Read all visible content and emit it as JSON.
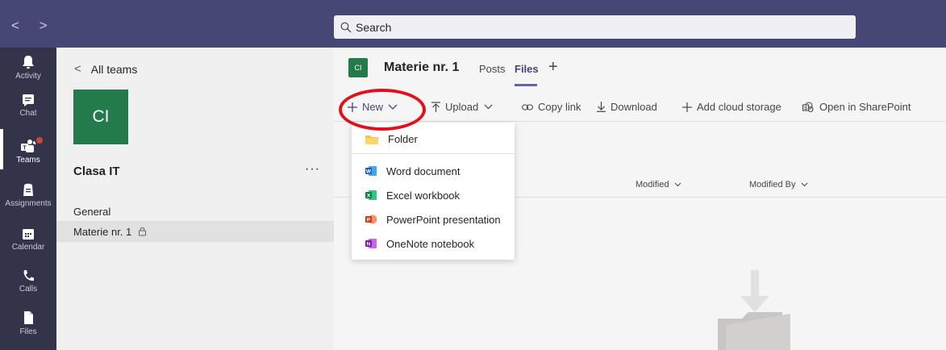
{
  "titlebar": {
    "nav": "< >",
    "search_placeholder": "Search"
  },
  "rail": {
    "items": [
      {
        "label": "Activity",
        "icon": "bell-icon"
      },
      {
        "label": "Chat",
        "icon": "chat-icon"
      },
      {
        "label": "Teams",
        "icon": "teams-icon",
        "active": true
      },
      {
        "label": "Assignments",
        "icon": "assignments-icon"
      },
      {
        "label": "Calendar",
        "icon": "calendar-icon"
      },
      {
        "label": "Calls",
        "icon": "phone-icon"
      },
      {
        "label": "Files",
        "icon": "files-icon"
      }
    ]
  },
  "teampanel": {
    "back_label": "All teams",
    "avatar_initials": "CI",
    "team_name": "Clasa IT",
    "more": "···",
    "channels": [
      {
        "label": "General"
      },
      {
        "label": "Materie nr. 1",
        "private": true
      }
    ]
  },
  "header": {
    "avatar_initials": "CI",
    "channel_title": "Materie nr. 1",
    "tabs": [
      {
        "label": "Posts"
      },
      {
        "label": "Files",
        "active": true
      }
    ],
    "add_tab": "+"
  },
  "toolbar": {
    "new_label": "New",
    "upload_label": "Upload",
    "copy_link_label": "Copy link",
    "download_label": "Download",
    "add_cloud_label": "Add cloud storage",
    "sharepoint_label": "Open in SharePoint"
  },
  "columns": {
    "modified": "Modified",
    "modified_by": "Modified By"
  },
  "new_menu": {
    "items": [
      {
        "label": "Folder",
        "icon": "folder-icon"
      },
      {
        "label": "Word document",
        "icon": "word-icon"
      },
      {
        "label": "Excel workbook",
        "icon": "excel-icon"
      },
      {
        "label": "PowerPoint presentation",
        "icon": "powerpoint-icon"
      },
      {
        "label": "OneNote notebook",
        "icon": "onenote-icon"
      }
    ]
  },
  "colors": {
    "titlebar": "#464775",
    "rail": "#33344a",
    "accent": "#6264a7",
    "team_green": "#237b4b",
    "annotation_red": "#e0111a"
  }
}
